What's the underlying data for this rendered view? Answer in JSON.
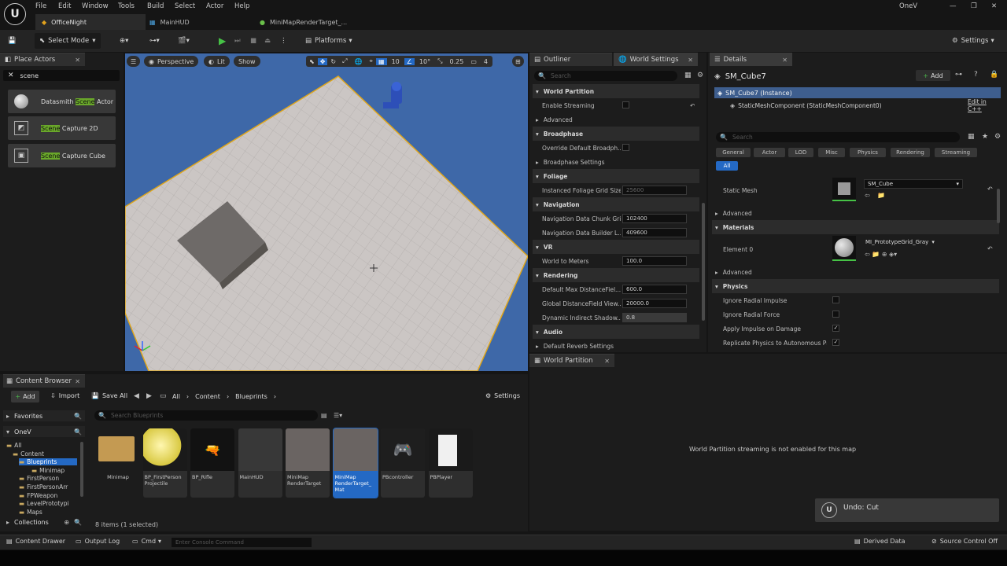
{
  "menu": [
    "File",
    "Edit",
    "Window",
    "Tools",
    "Build",
    "Select",
    "Actor",
    "Help"
  ],
  "project_name": "OneV",
  "doc_tabs": [
    "OfficeNight",
    "MainHUD",
    "MiniMapRenderTarget_..."
  ],
  "toolbar": {
    "select_mode": "Select Mode",
    "platforms": "Platforms",
    "settings": "Settings"
  },
  "place_actors": {
    "title": "Place Actors",
    "search_value": "scene",
    "items": [
      {
        "pre": "Datasmith ",
        "hl": "Scene",
        "post": " Actor"
      },
      {
        "pre": "",
        "hl": "Scene",
        "post": " Capture 2D"
      },
      {
        "pre": "",
        "hl": "Scene",
        "post": " Capture Cube"
      }
    ]
  },
  "viewport": {
    "perspective": "Perspective",
    "lit": "Lit",
    "show": "Show",
    "grid": "10",
    "angle": "10°",
    "scale": "0.25",
    "cam": "4"
  },
  "outliner": {
    "tab": "Outliner",
    "world_tab": "World Settings",
    "search_placeholder": "Search"
  },
  "world_settings": {
    "rows": [
      {
        "cat": "World Partition"
      },
      {
        "label": "Enable Streaming",
        "check": true
      },
      {
        "sub": "Advanced"
      },
      {
        "cat": "Broadphase"
      },
      {
        "label": "Override Default Broadph...",
        "check": true
      },
      {
        "sub": "Broadphase Settings"
      },
      {
        "cat": "Foliage"
      },
      {
        "label": "Instanced Foliage Grid Size",
        "value": "25600",
        "dim": true
      },
      {
        "cat": "Navigation"
      },
      {
        "label": "Navigation Data Chunk Gri...",
        "value": "102400"
      },
      {
        "label": "Navigation Data Builder L...",
        "value": "409600"
      },
      {
        "cat": "VR"
      },
      {
        "label": "World to Meters",
        "value": "100.0"
      },
      {
        "cat": "Rendering"
      },
      {
        "label": "Default Max DistanceFiel...",
        "value": "600.0"
      },
      {
        "label": "Global DistanceField View...",
        "value": "20000.0"
      },
      {
        "label": "Dynamic Indirect Shadow...",
        "value": "0.8",
        "slider": true
      },
      {
        "cat": "Audio"
      },
      {
        "sub": "Default Reverb Settings"
      }
    ]
  },
  "details": {
    "tab": "Details",
    "object": "SM_Cube7",
    "add": "Add",
    "instance": "SM_Cube7 (Instance)",
    "component": "StaticMeshComponent (StaticMeshComponent0)",
    "edit_cpp": "Edit in C++",
    "search_placeholder": "Search",
    "filters": [
      "General",
      "Actor",
      "LOD",
      "Misc",
      "Physics",
      "Rendering",
      "Streaming"
    ],
    "all": "All",
    "static_mesh_label": "Static Mesh",
    "static_mesh_value": "SM_Cube",
    "advanced": "Advanced",
    "materials": "Materials",
    "element0": "Element 0",
    "material_value": "MI_PrototypeGrid_Gray",
    "physics": "Physics",
    "phys_rows": [
      {
        "label": "Ignore Radial Impulse",
        "checked": false
      },
      {
        "label": "Ignore Radial Force",
        "checked": false
      },
      {
        "label": "Apply Impulse on Damage",
        "checked": true
      },
      {
        "label": "Replicate Physics to Autonomous Pr...",
        "checked": true
      }
    ]
  },
  "world_partition": {
    "tab": "World Partition",
    "message": "World Partition streaming is not enabled for this map"
  },
  "undo_toast": "Undo: Cut",
  "content_browser": {
    "title": "Content Browser",
    "add": "Add",
    "import": "Import",
    "save_all": "Save All",
    "breadcrumb": [
      "All",
      "Content",
      "Blueprints"
    ],
    "settings": "Settings",
    "favorites": "Favorites",
    "project": "OneV",
    "collections": "Collections",
    "search_placeholder": "Search Blueprints",
    "tree": [
      "All",
      "Content",
      "Blueprints",
      "Minimap",
      "FirstPerson",
      "FirstPersonArr",
      "FPWeapon",
      "LevelPrototypi",
      "Maps"
    ],
    "assets": [
      {
        "name": "Minimap"
      },
      {
        "name": "BP_FirstPerson Projectile"
      },
      {
        "name": "BP_Rifle"
      },
      {
        "name": "MainHUD"
      },
      {
        "name": "MiniMap RenderTarget"
      },
      {
        "name": "MiniMap RenderTarget_ Mat"
      },
      {
        "name": "PBcontroller"
      },
      {
        "name": "PBPlayer"
      }
    ],
    "count": "8 items (1 selected)"
  },
  "statusbar": {
    "drawer": "Content Drawer",
    "output": "Output Log",
    "cmd": "Cmd",
    "console_placeholder": "Enter Console Command",
    "derived": "Derived Data",
    "source": "Source Control Off"
  }
}
